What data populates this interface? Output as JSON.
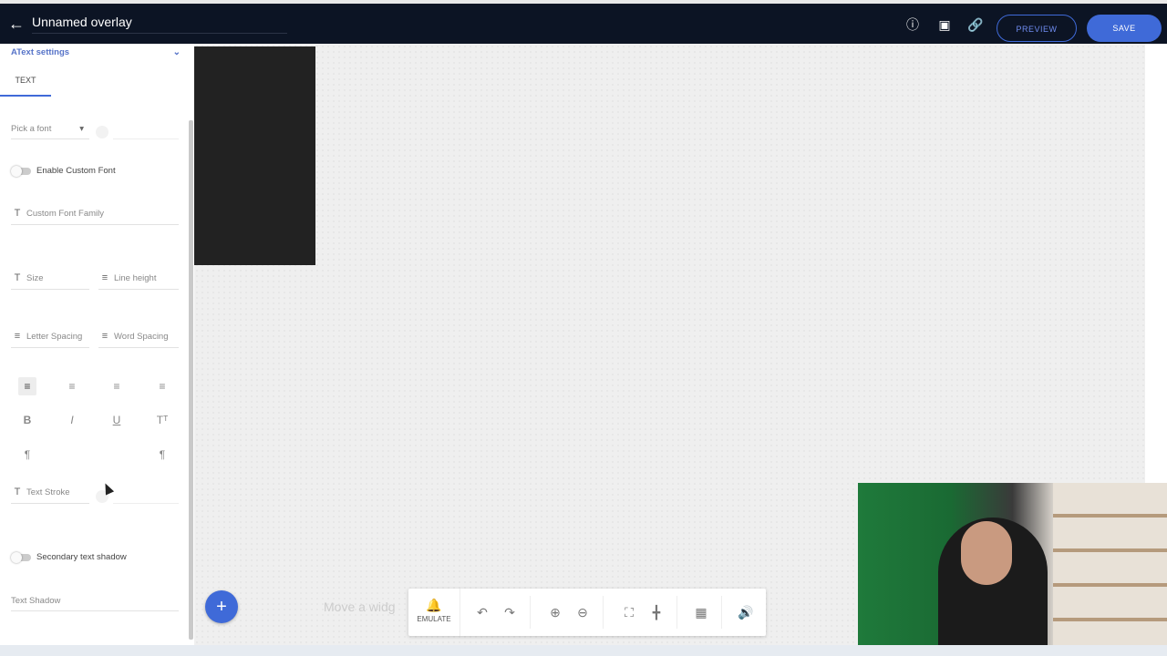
{
  "header": {
    "title": "Unnamed overlay",
    "preview_label": "PREVIEW",
    "save_label": "SAVE",
    "back_icon": "arrow-left-icon",
    "icons": [
      "help-icon",
      "emulate-screen-icon",
      "link-icon"
    ]
  },
  "sidebar": {
    "section_title": "Text settings",
    "tab": "TEXT",
    "font_picker": "Pick a font",
    "enable_custom_font": "Enable Custom Font",
    "custom_font_family": "Custom Font Family",
    "size": "Size",
    "line_height": "Line height",
    "letter_spacing": "Letter Spacing",
    "word_spacing": "Word Spacing",
    "text_stroke": "Text Stroke",
    "secondary_text_shadow": "Secondary text shadow",
    "text_shadow": "Text Shadow"
  },
  "canvas": {
    "ghost_text": "Move a widg",
    "emulate_label": "EMULATE"
  },
  "colors": {
    "header_bg": "#0c1424",
    "accent": "#3f6ad8",
    "canvas_bg": "#efefef"
  }
}
